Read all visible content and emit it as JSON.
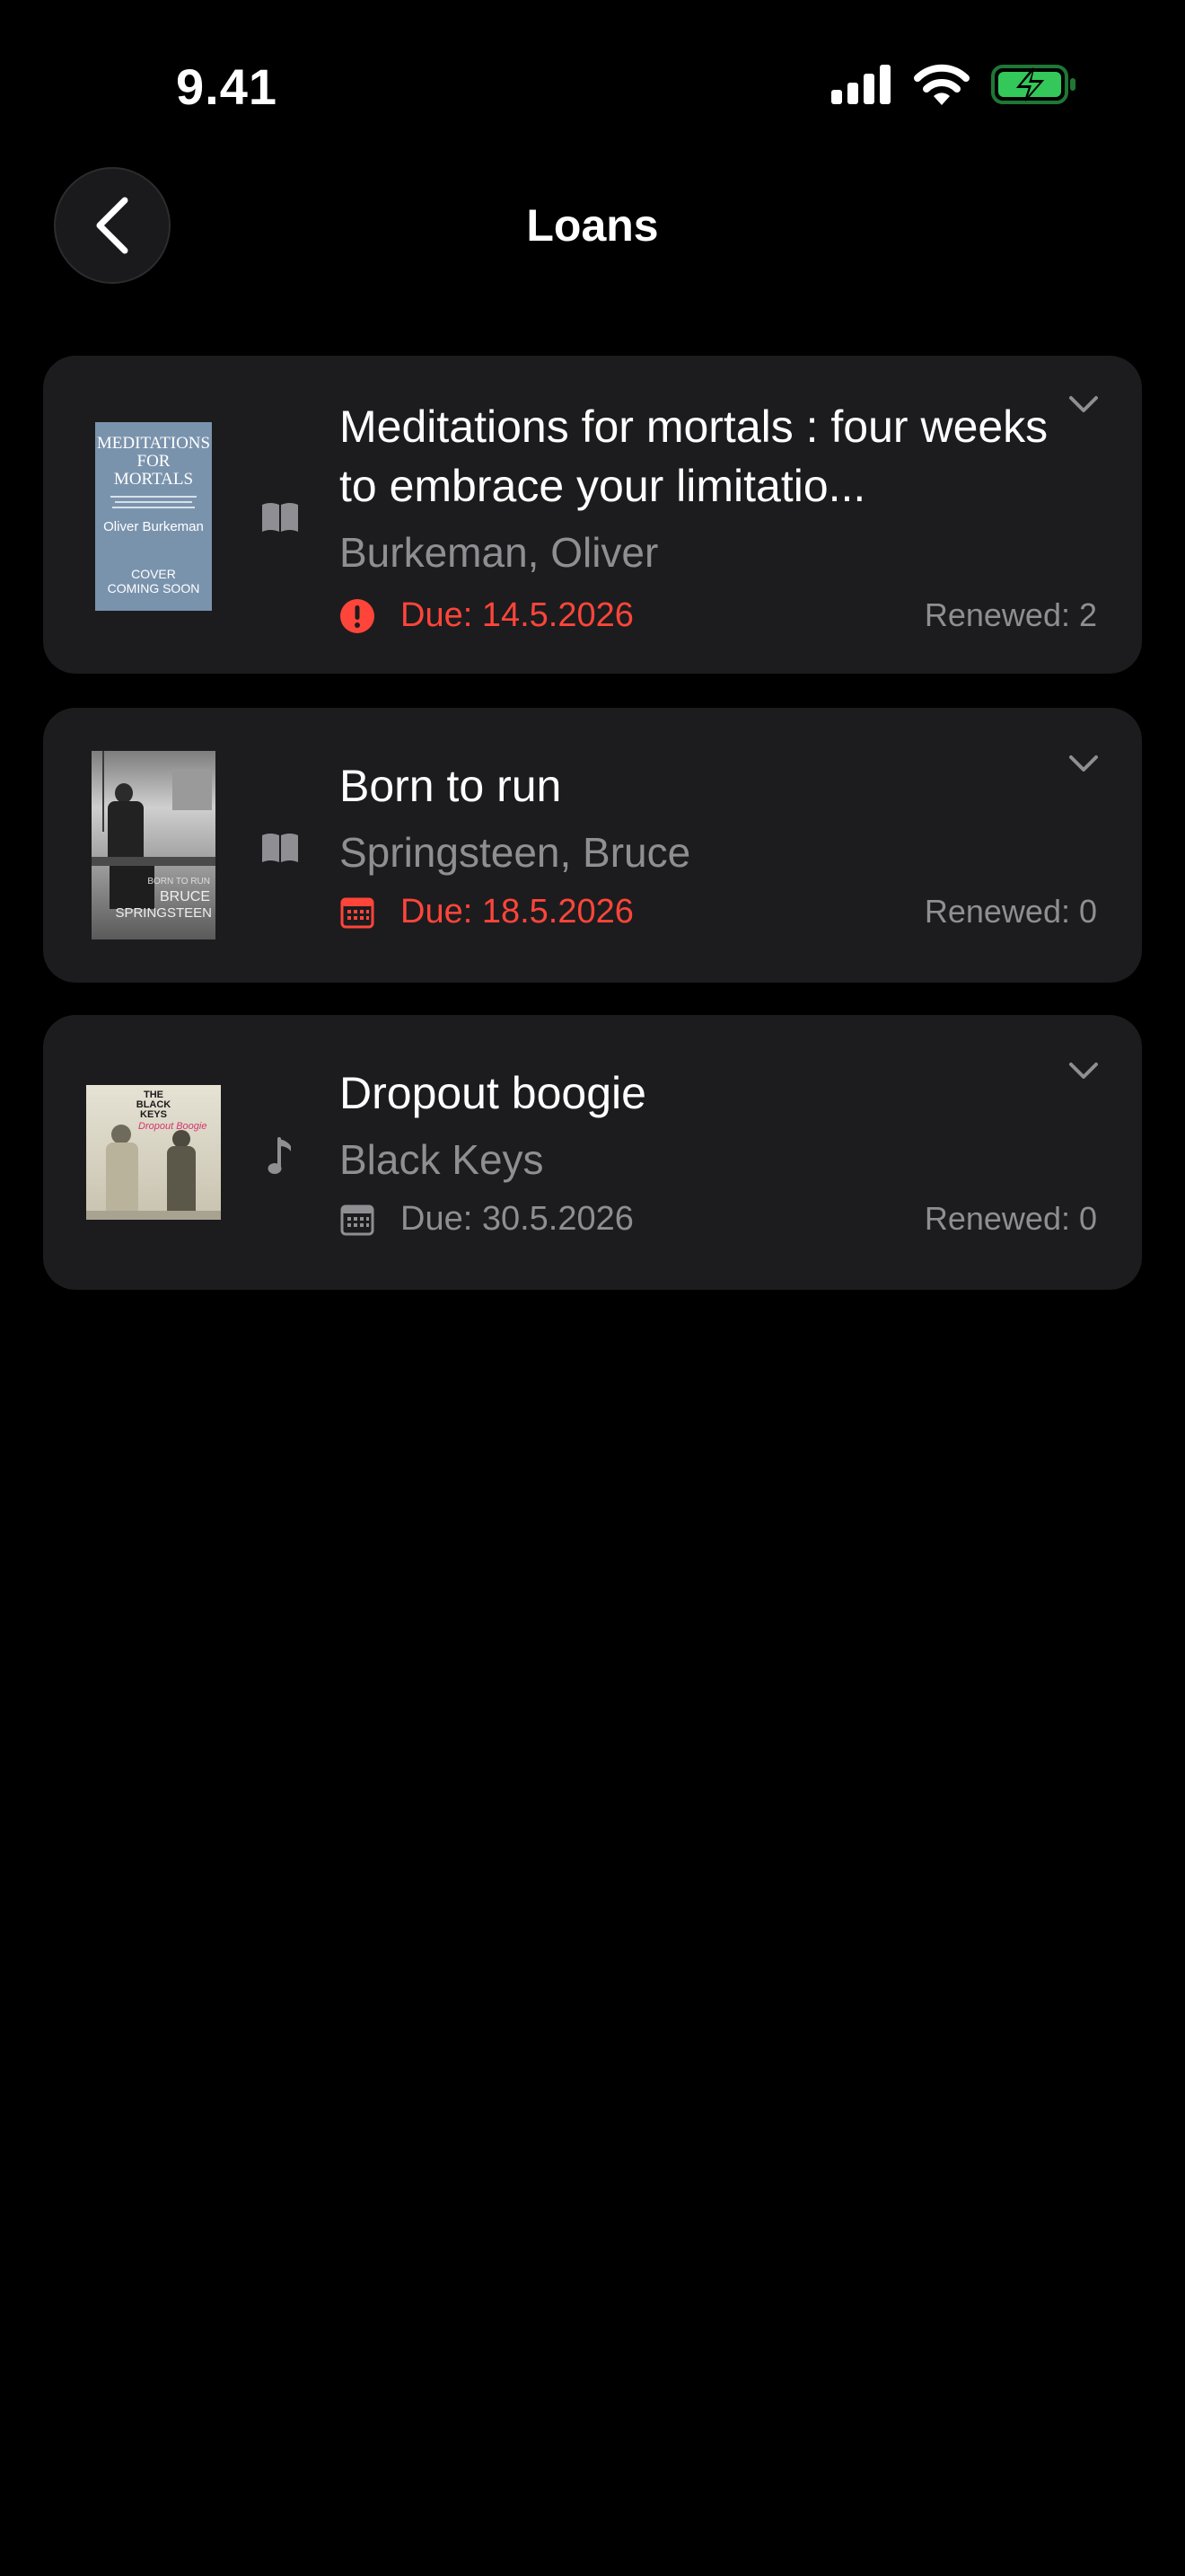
{
  "status_bar": {
    "time": "9.41"
  },
  "header": {
    "title": "Loans"
  },
  "loans": [
    {
      "title": "Meditations for mortals : four weeks to embrace your limitatio...",
      "author": "Burkeman, Oliver",
      "due": "Due: 14.5.2026",
      "renewed": "Renewed: 2",
      "type_icon": "book-icon",
      "due_icon": "alert-icon",
      "due_color": "#ff453a",
      "cover": {
        "background": "#7a93ad",
        "line1": "MEDITATIONS",
        "line2": "FOR",
        "line3": "MORTALS",
        "author": "Oliver Burkeman",
        "badge1": "COVER",
        "badge2": "COMING SOON"
      }
    },
    {
      "title": "Born to run",
      "author": "Springsteen, Bruce",
      "due": "Due: 18.5.2026",
      "renewed": "Renewed: 0",
      "type_icon": "book-icon",
      "due_icon": "calendar-icon",
      "due_color": "#ff453a",
      "cover": {
        "small": "BORN TO RUN",
        "name1": "BRUCE",
        "name2": "SPRINGSTEEN"
      }
    },
    {
      "title": "Dropout boogie",
      "author": "Black Keys",
      "due": "Due: 30.5.2026",
      "renewed": "Renewed: 0",
      "type_icon": "music-note-icon",
      "due_icon": "calendar-icon",
      "due_color": "#8e8e93",
      "cover": {
        "band1": "THE",
        "band2": "BLACK",
        "band3": "KEYS",
        "album": "Dropout Boogie"
      }
    }
  ],
  "colors": {
    "background": "#000000",
    "card": "#1c1c1e",
    "overdue": "#ff453a",
    "secondary_text": "#8e8e93",
    "battery": "#34c759"
  }
}
